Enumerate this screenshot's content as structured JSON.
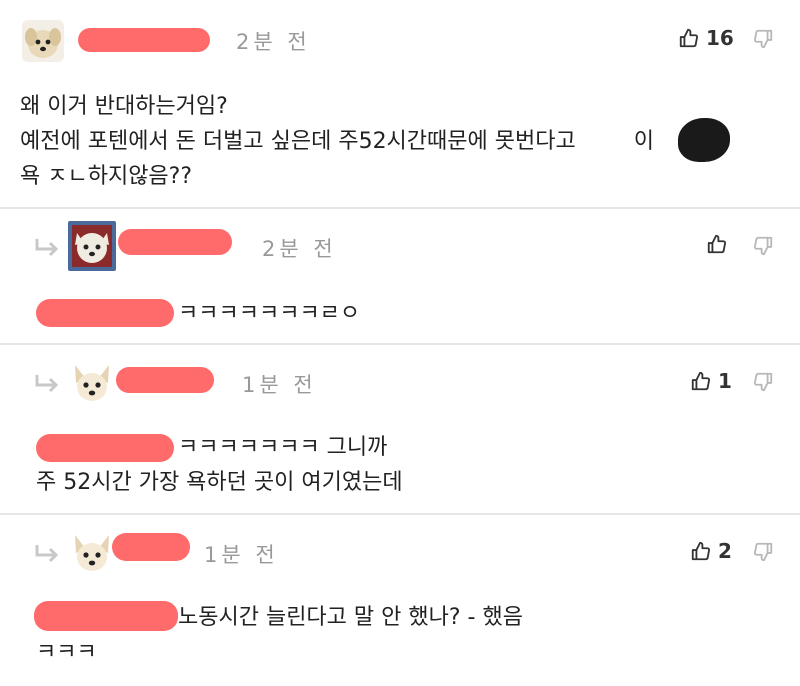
{
  "comments": [
    {
      "time": "2분 전",
      "likes": "16",
      "lines": [
        "왜 이거 반대하는거임?",
        "예전에 포텐에서 돈 더벌고 싶은데 주52시간때문에 못번다고",
        "이",
        "욕 ㅈㄴ하지않음??"
      ]
    },
    {
      "time": "2분 전",
      "likes": "",
      "lines": [
        "ㅋㅋㅋㅋㅋㅋㅋㄹㅇ"
      ]
    },
    {
      "time": "1분 전",
      "likes": "1",
      "lines": [
        "ㅋㅋㅋㅋㅋㅋㅋ 그니까",
        "주 52시간 가장 욕하던 곳이 여기였는데"
      ]
    },
    {
      "time": "1분 전",
      "likes": "2",
      "lines": [
        "노동시간 늘린다고 말 안 했나? - 했음",
        "ㅋㅋㅋ"
      ]
    }
  ],
  "icons": {
    "like": "thumbs-up-icon",
    "dislike": "thumbs-down-icon",
    "reply": "reply-arrow-icon"
  },
  "colors": {
    "redaction": "#ff6b6b",
    "divider": "#e6e6e6",
    "meta_text": "#999999"
  }
}
